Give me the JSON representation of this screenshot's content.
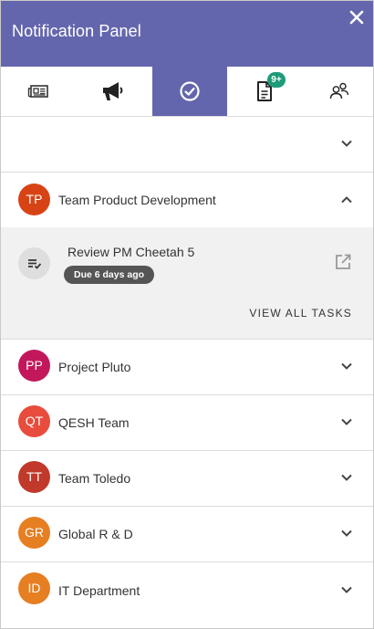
{
  "header": {
    "title": "Notification Panel",
    "close_icon": "close-icon"
  },
  "tabs": [
    {
      "id": "news",
      "icon": "newspaper-icon",
      "active": false
    },
    {
      "id": "announcements",
      "icon": "megaphone-icon",
      "active": false
    },
    {
      "id": "tasks",
      "icon": "check-circle-icon",
      "active": true
    },
    {
      "id": "documents",
      "icon": "document-icon",
      "active": false,
      "badge": "9+"
    },
    {
      "id": "people",
      "icon": "people-icon",
      "active": false
    }
  ],
  "groups": [
    {
      "initials": "TP",
      "name": "Team Product Development",
      "color": "#d84315",
      "expanded": true
    },
    {
      "initials": "PP",
      "name": "Project Pluto",
      "color": "#c2185b",
      "expanded": false
    },
    {
      "initials": "QT",
      "name": "QESH Team",
      "color": "#e84c3d",
      "expanded": false
    },
    {
      "initials": "TT",
      "name": "Team Toledo",
      "color": "#c0392b",
      "expanded": false
    },
    {
      "initials": "GR",
      "name": "Global R & D",
      "color": "#e67e22",
      "expanded": false
    },
    {
      "initials": "ID",
      "name": "IT Department",
      "color": "#e67e22",
      "expanded": false
    }
  ],
  "task": {
    "title": "Review PM Cheetah 5",
    "due": "Due 6 days ago",
    "view_all": "VIEW ALL TASKS"
  },
  "colors": {
    "accent": "#6466ad",
    "badge": "#1e9b78"
  }
}
